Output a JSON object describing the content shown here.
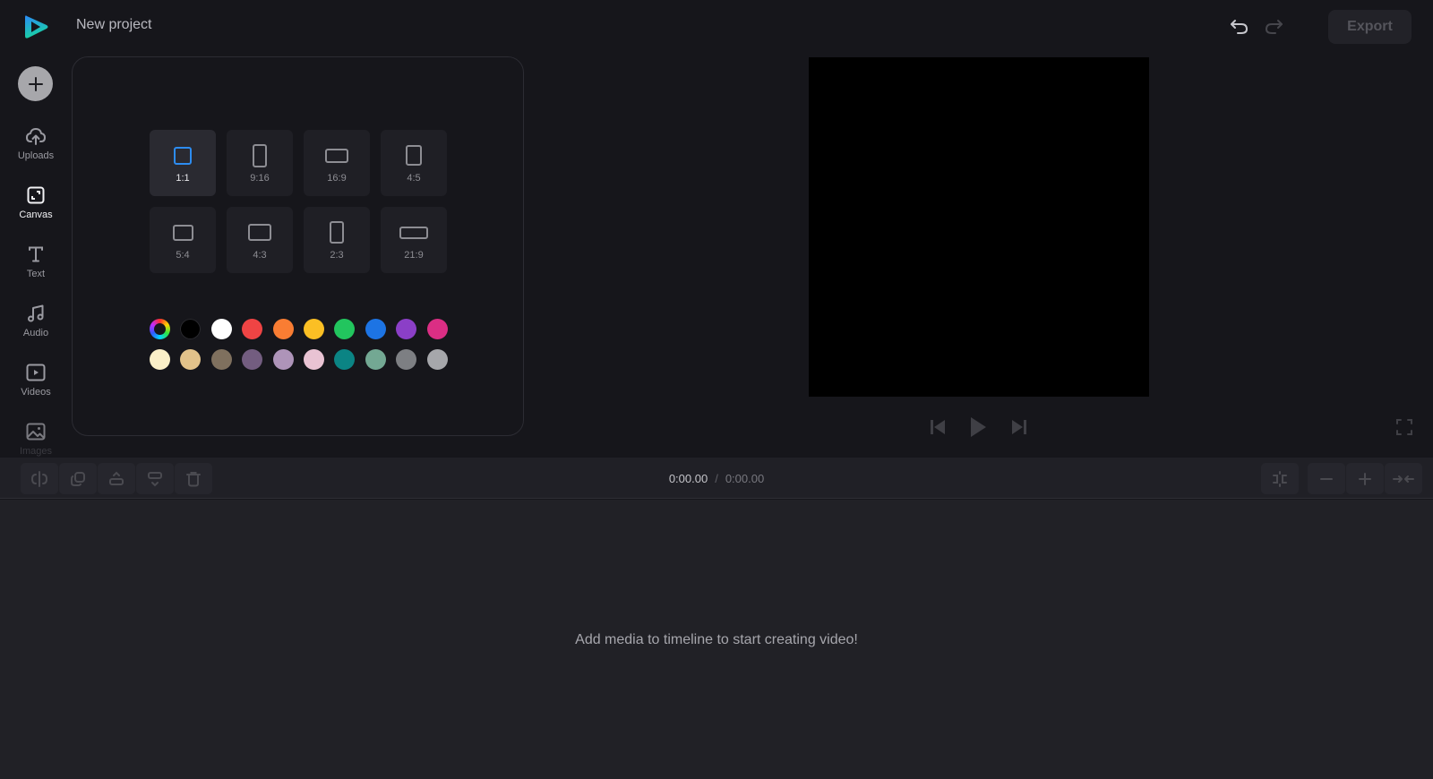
{
  "app": {
    "logo_icon": "play-logo-icon",
    "project_title": "New project"
  },
  "header": {
    "undo_icon": "undo-icon",
    "redo_icon": "redo-icon",
    "export_label": "Export",
    "export_enabled": false
  },
  "sidebar": {
    "add_icon": "plus-icon",
    "items": [
      {
        "label": "Uploads",
        "icon": "cloud-upload-icon",
        "active": false
      },
      {
        "label": "Canvas",
        "icon": "canvas-resize-icon",
        "active": true
      },
      {
        "label": "Text",
        "icon": "text-icon",
        "active": false
      },
      {
        "label": "Audio",
        "icon": "music-note-icon",
        "active": false
      },
      {
        "label": "Videos",
        "icon": "video-play-icon",
        "active": false
      },
      {
        "label": "Images",
        "icon": "image-icon",
        "active": false
      }
    ]
  },
  "canvas_panel": {
    "selected_ratio": "1:1",
    "ratios": [
      {
        "label": "1:1"
      },
      {
        "label": "9:16"
      },
      {
        "label": "16:9"
      },
      {
        "label": "4:5"
      },
      {
        "label": "5:4"
      },
      {
        "label": "4:3"
      },
      {
        "label": "2:3"
      },
      {
        "label": "21:9"
      }
    ],
    "colors": [
      "custom-picker",
      "#000000",
      "#ffffff",
      "#ef4444",
      "#f97d33",
      "#fbbf24",
      "#22c55e",
      "#1d74e4",
      "#8b3fc7",
      "#db2e84",
      "#fbf0c8",
      "#e2c28a",
      "#7f705e",
      "#735d80",
      "#ae94b9",
      "#e9c3d3",
      "#0b8484",
      "#73a893",
      "#7d7f83",
      "#a6a7ab"
    ]
  },
  "preview": {
    "background": "#000000",
    "controls": {
      "skip_back_icon": "skip-back-icon",
      "play_icon": "play-icon",
      "skip_forward_icon": "skip-forward-icon",
      "fullscreen_icon": "fullscreen-icon"
    }
  },
  "timeline_toolbar": {
    "tools": [
      {
        "name": "split",
        "icon": "split-icon"
      },
      {
        "name": "duplicate",
        "icon": "duplicate-icon"
      },
      {
        "name": "move-up",
        "icon": "move-up-icon"
      },
      {
        "name": "move-down",
        "icon": "move-down-icon"
      },
      {
        "name": "delete",
        "icon": "trash-icon"
      }
    ],
    "current_time": "0:00.00",
    "separator": "/",
    "total_time": "0:00.00",
    "right_tools": [
      {
        "name": "snap",
        "icon": "snap-icon"
      },
      {
        "name": "zoom-out",
        "icon": "minus-icon"
      },
      {
        "name": "zoom-in",
        "icon": "plus-icon"
      },
      {
        "name": "fit",
        "icon": "fit-to-screen-icon"
      }
    ]
  },
  "timeline": {
    "empty_message": "Add media to timeline to start creating video!"
  }
}
